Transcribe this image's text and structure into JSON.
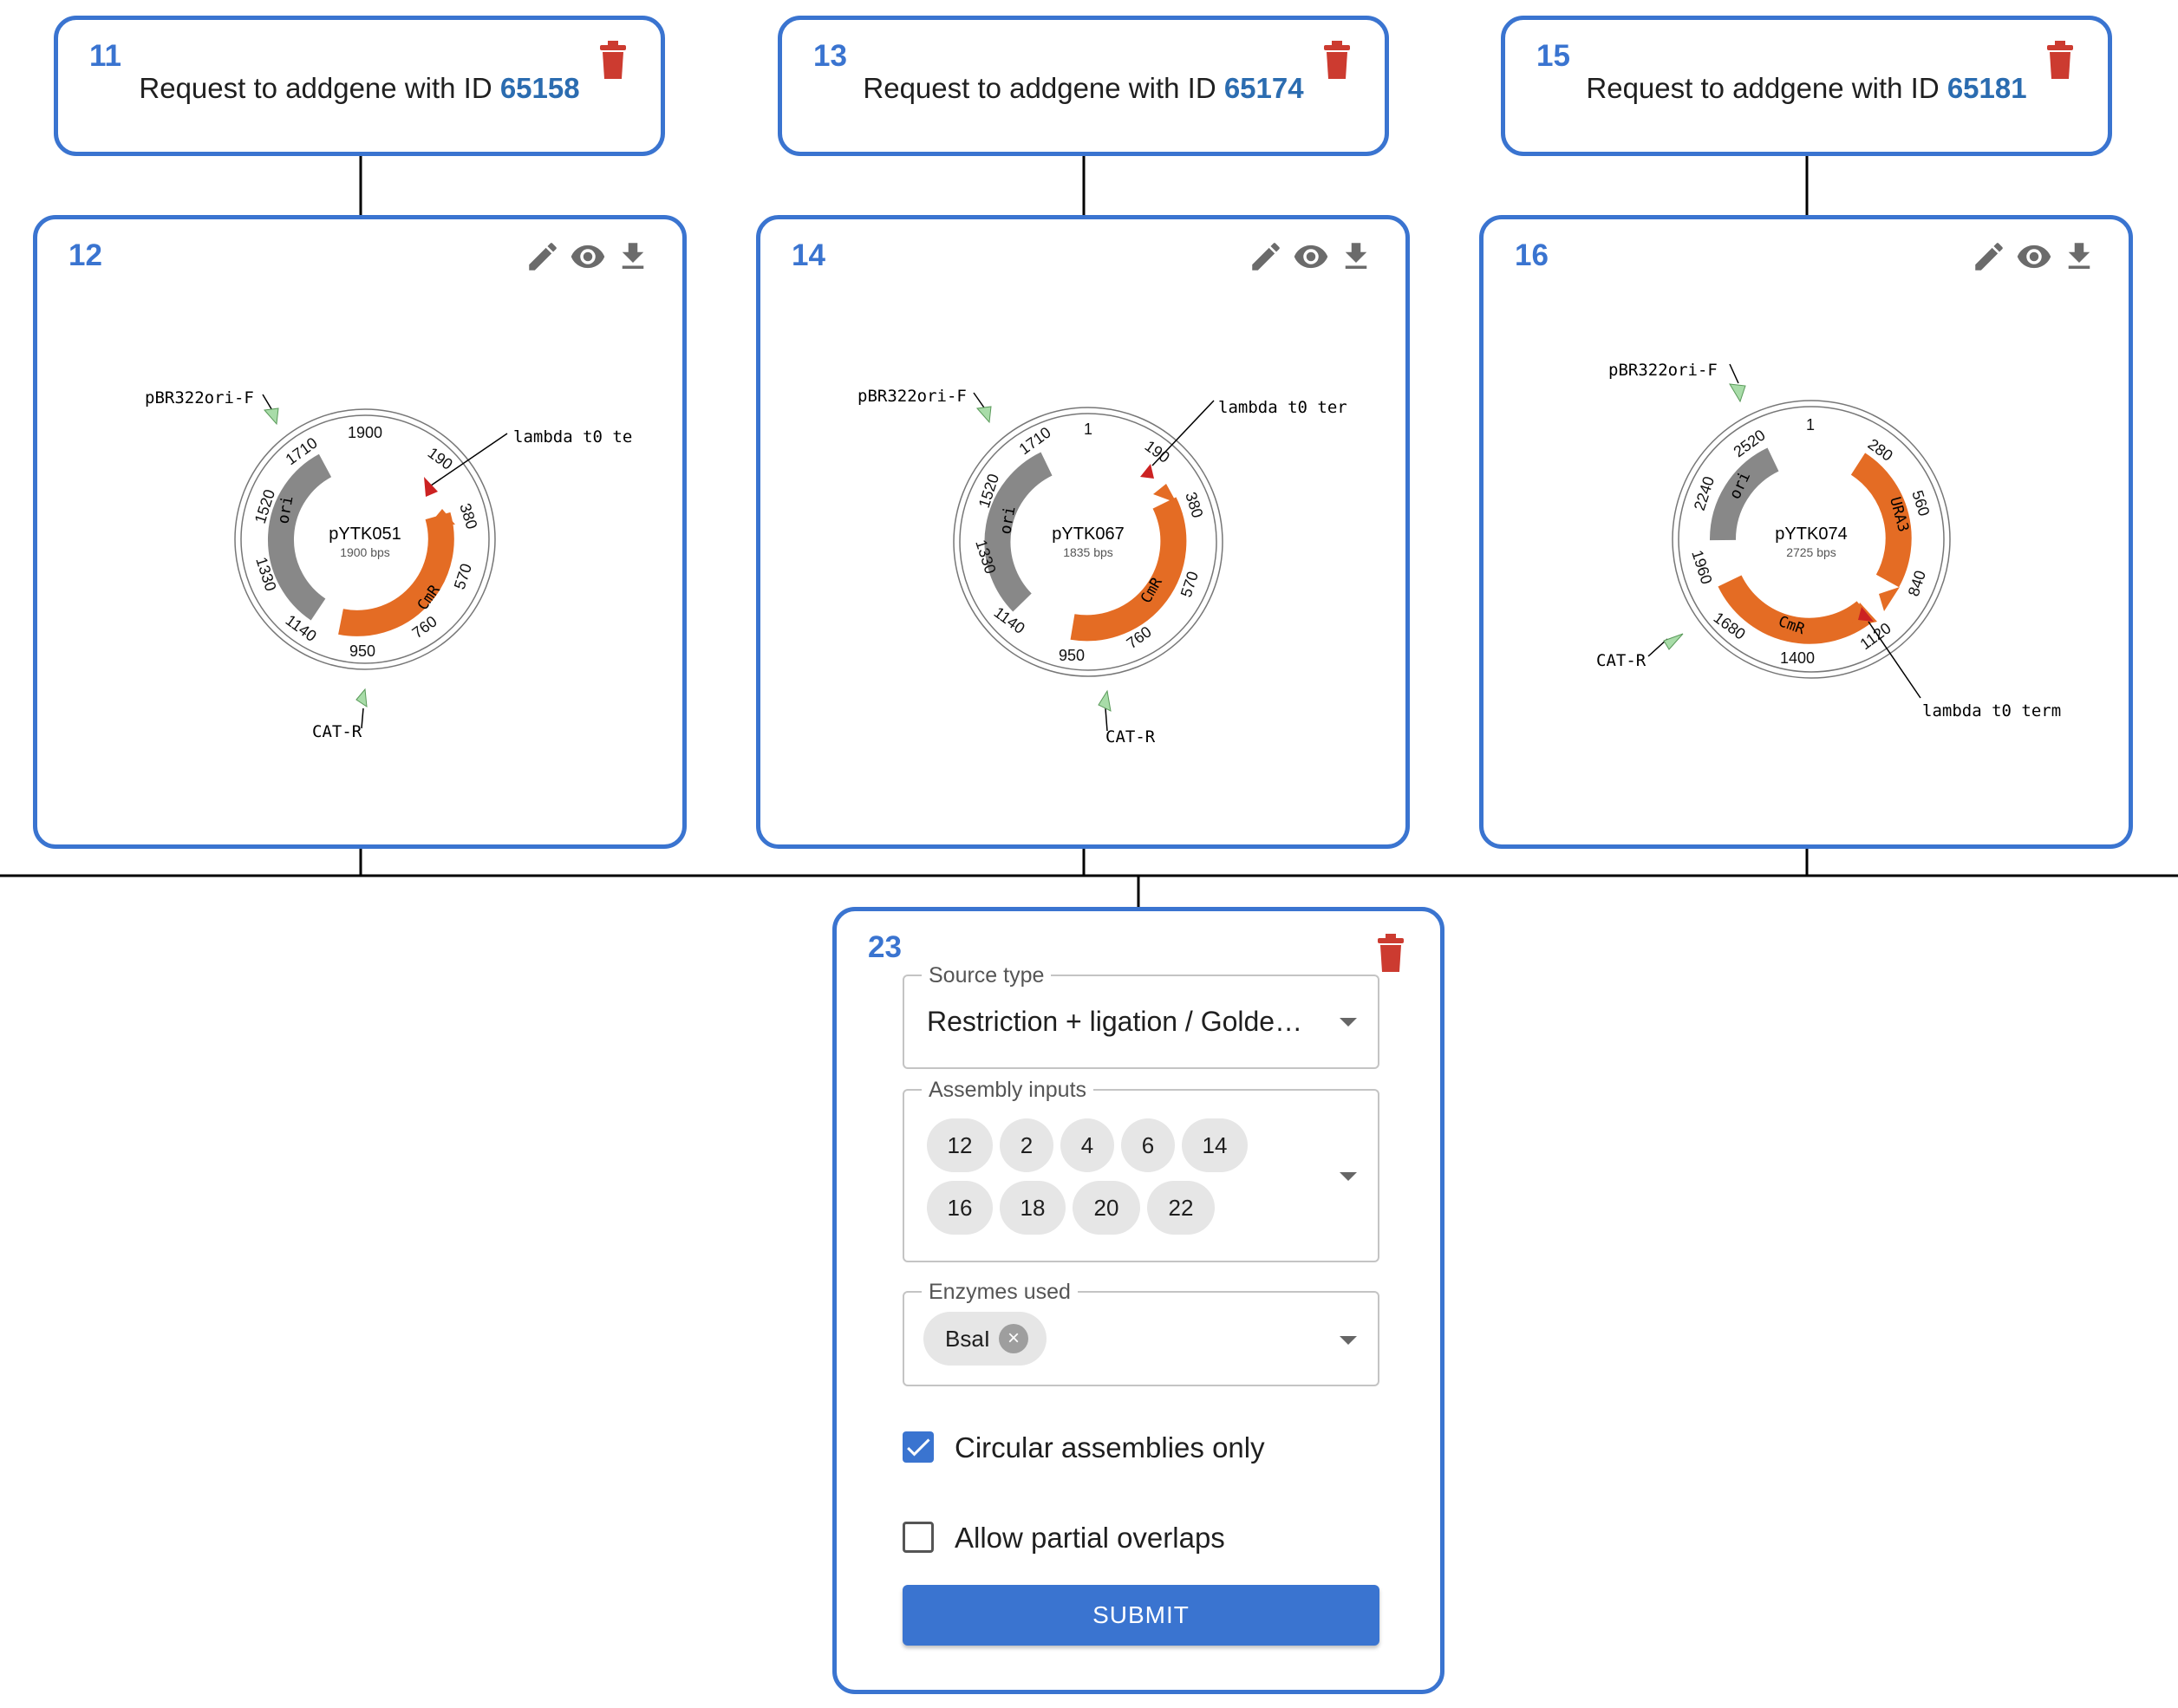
{
  "source_nodes": [
    {
      "id": "11",
      "text": "Request to addgene with ID",
      "addgene_id": "65158"
    },
    {
      "id": "13",
      "text": "Request to addgene with ID",
      "addgene_id": "65174"
    },
    {
      "id": "15",
      "text": "Request to addgene with ID",
      "addgene_id": "65181"
    }
  ],
  "sequence_nodes": [
    {
      "id": "12",
      "name": "pYTK051",
      "size_label": "1900 bps",
      "primer_f": "pBR322ori-F",
      "primer_r": "CAT-R",
      "terminator": "lambda t0 te",
      "feature_ori": "ori",
      "feature_cmr": "CmR",
      "ticks": [
        "1900",
        "190",
        "380",
        "570",
        "760",
        "950",
        "1140",
        "1330",
        "1520",
        "1710"
      ]
    },
    {
      "id": "14",
      "name": "pYTK067",
      "size_label": "1835 bps",
      "primer_f": "pBR322ori-F",
      "primer_r": "CAT-R",
      "terminator": "lambda t0 ter",
      "feature_ori": "ori",
      "feature_cmr": "CmR",
      "ticks": [
        "1",
        "190",
        "380",
        "570",
        "760",
        "950",
        "1140",
        "1330",
        "1520",
        "1710"
      ]
    },
    {
      "id": "16",
      "name": "pYTK074",
      "size_label": "2725 bps",
      "primer_f": "pBR322ori-F",
      "primer_r": "CAT-R",
      "terminator": "lambda t0 term",
      "feature_ori": "ori",
      "feature_cmr": "CmR",
      "feature_ura3": "URA3",
      "ticks": [
        "1",
        "280",
        "560",
        "840",
        "1120",
        "1400",
        "1680",
        "1960",
        "2240",
        "2520"
      ]
    }
  ],
  "assembly_node": {
    "id": "23",
    "source_type_label": "Source type",
    "source_type_value": "Restriction + ligation / Golde…",
    "assembly_inputs_label": "Assembly inputs",
    "assembly_inputs": [
      "12",
      "2",
      "4",
      "6",
      "14",
      "16",
      "18",
      "20",
      "22"
    ],
    "enzymes_label": "Enzymes used",
    "enzymes": [
      "BsaI"
    ],
    "circular_only_label": "Circular assemblies only",
    "circular_only_checked": true,
    "partial_overlaps_label": "Allow partial overlaps",
    "partial_overlaps_checked": false,
    "submit_label": "SUBMIT"
  },
  "icons": {
    "delete": "trash-icon",
    "edit": "pencil-icon",
    "view": "eye-icon",
    "download": "download-icon",
    "check": "check-icon",
    "chip_delete": "cancel-circle-icon",
    "dropdown": "caret-down-icon"
  },
  "colors": {
    "node_border": "#3a74d0",
    "node_id": "#3a74d0",
    "addgene_link": "#2b6cb0",
    "trash": "#cc3b30",
    "cmr_feature": "#e46c24",
    "ori_feature": "#7f7f7f",
    "primer": "#a8dca8",
    "terminator": "#cc2222",
    "submit_bg": "#3a74d0"
  }
}
